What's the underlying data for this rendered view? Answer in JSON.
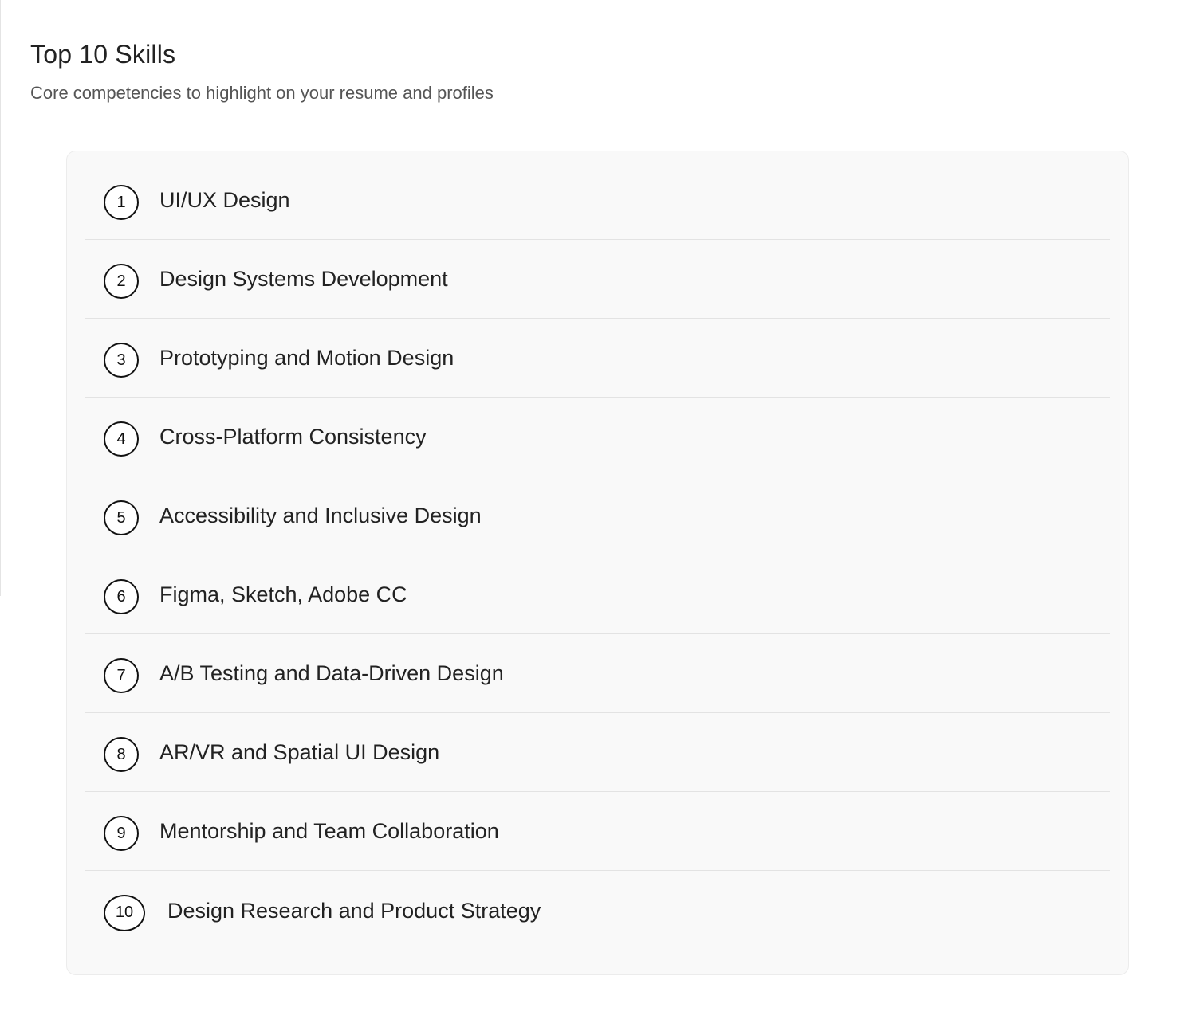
{
  "header": {
    "title": "Top 10 Skills",
    "subtitle": "Core competencies to highlight on your resume and profiles"
  },
  "skills": [
    {
      "rank": "1",
      "label": "UI/UX Design"
    },
    {
      "rank": "2",
      "label": "Design Systems Development"
    },
    {
      "rank": "3",
      "label": "Prototyping and Motion Design"
    },
    {
      "rank": "4",
      "label": "Cross-Platform Consistency"
    },
    {
      "rank": "5",
      "label": "Accessibility and Inclusive Design"
    },
    {
      "rank": "6",
      "label": "Figma, Sketch, Adobe CC"
    },
    {
      "rank": "7",
      "label": "A/B Testing and Data-Driven Design"
    },
    {
      "rank": "8",
      "label": "AR/VR and Spatial UI Design"
    },
    {
      "rank": "9",
      "label": "Mentorship and Team Collaboration"
    },
    {
      "rank": "10",
      "label": "Design Research and Product Strategy"
    }
  ],
  "colors": {
    "card_background": "#f9f9f9",
    "divider": "#e3e3e3",
    "text": "#222222",
    "subtitle": "#555555"
  }
}
